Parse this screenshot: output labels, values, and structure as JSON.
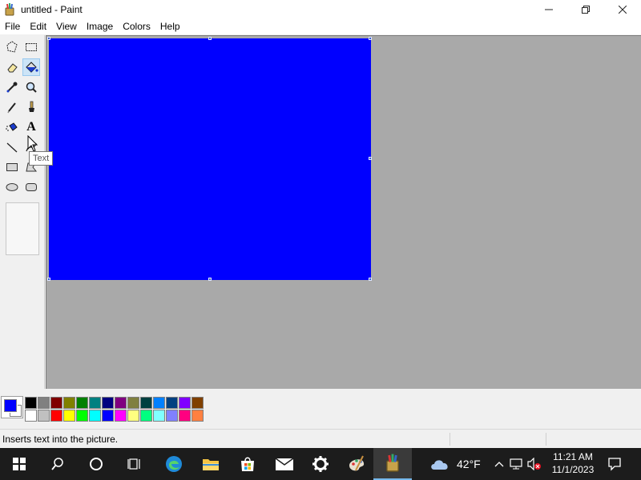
{
  "window": {
    "title": "untitled - Paint",
    "controls": {
      "minimize": "—",
      "maximize": "❐",
      "close": "✕"
    }
  },
  "menu": [
    "File",
    "Edit",
    "View",
    "Image",
    "Colors",
    "Help"
  ],
  "tools": [
    {
      "name": "free-form-select",
      "icon": "free-select-icon"
    },
    {
      "name": "select",
      "icon": "rect-select-icon"
    },
    {
      "name": "eraser",
      "icon": "eraser-icon"
    },
    {
      "name": "fill-with-color",
      "icon": "paint-bucket-icon",
      "selected": true
    },
    {
      "name": "pick-color",
      "icon": "eyedropper-icon"
    },
    {
      "name": "magnifier",
      "icon": "magnifier-icon"
    },
    {
      "name": "pencil",
      "icon": "pencil-icon"
    },
    {
      "name": "brush",
      "icon": "brush-icon"
    },
    {
      "name": "airbrush",
      "icon": "airbrush-icon"
    },
    {
      "name": "text",
      "icon": "text-icon",
      "glyph": "A"
    },
    {
      "name": "line",
      "icon": "line-icon"
    },
    {
      "name": "curve",
      "icon": "curve-icon"
    },
    {
      "name": "rectangle",
      "icon": "rectangle-icon"
    },
    {
      "name": "polygon",
      "icon": "polygon-icon"
    },
    {
      "name": "ellipse",
      "icon": "ellipse-icon"
    },
    {
      "name": "rounded-rectangle",
      "icon": "rounded-rect-icon"
    }
  ],
  "tooltip": "Text",
  "canvas": {
    "fill_color": "#0000ff"
  },
  "current_colors": {
    "foreground": "#0000ff",
    "background": "#ffffff"
  },
  "palette": {
    "row1": [
      "#000000",
      "#808080",
      "#800000",
      "#808000",
      "#008000",
      "#008080",
      "#000080",
      "#800080",
      "#808040",
      "#004040",
      "#0080ff",
      "#004080",
      "#8000ff",
      "#804000"
    ],
    "row2": [
      "#ffffff",
      "#c0c0c0",
      "#ff0000",
      "#ffff00",
      "#00ff00",
      "#00ffff",
      "#0000ff",
      "#ff00ff",
      "#ffff80",
      "#00ff80",
      "#80ffff",
      "#8080ff",
      "#ff0080",
      "#ff8040"
    ]
  },
  "status": {
    "text": "Inserts text into the picture."
  },
  "taskbar": {
    "buttons": [
      "start",
      "search",
      "cortana",
      "task-view",
      "edge",
      "file-explorer",
      "store",
      "mail",
      "settings",
      "paint-3d",
      "paint"
    ],
    "weather": {
      "temp": "42°F"
    },
    "clock": {
      "time": "11:21 AM",
      "date": "11/1/2023"
    }
  }
}
